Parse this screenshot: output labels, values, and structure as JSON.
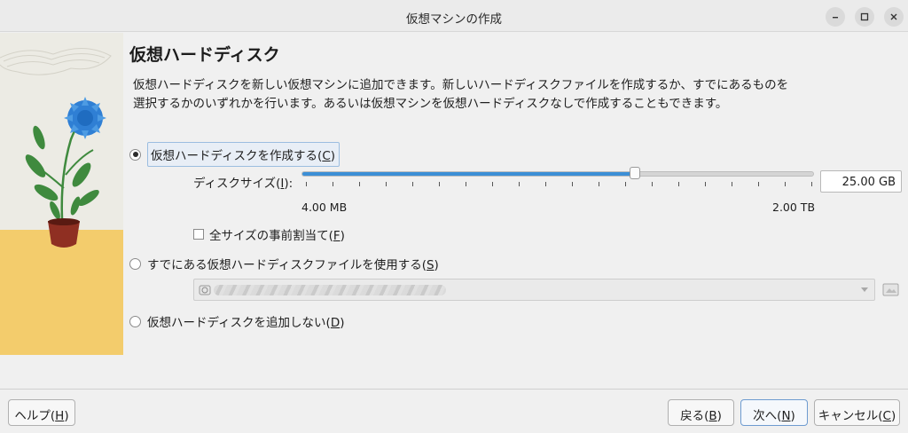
{
  "window": {
    "title": "仮想マシンの作成"
  },
  "page": {
    "heading": "仮想ハードディスク",
    "description": "仮想ハードディスクを新しい仮想マシンに追加できます。新しいハードディスクファイルを作成するか、すでにあるものを選択するかのいずれかを行います。あるいは仮想マシンを仮想ハードディスクなしで作成することもできます。"
  },
  "options": {
    "create": {
      "label": "仮想ハードディスクを作成する(",
      "mnemonic": "C",
      "label_end": ")",
      "selected": true
    },
    "existing": {
      "label": "すでにある仮想ハードディスクファイルを使用する(",
      "mnemonic": "S",
      "label_end": ")",
      "selected": false
    },
    "none": {
      "label": "仮想ハードディスクを追加しない(",
      "mnemonic": "D",
      "label_end": ")",
      "selected": false
    }
  },
  "disk_size": {
    "label": "ディスクサイズ(",
    "mnemonic": "I",
    "label_end": "):",
    "value": "25.00 GB",
    "min_label": "4.00 MB",
    "max_label": "2.00 TB",
    "slider_fraction": 0.65
  },
  "preallocate": {
    "label": "全サイズの事前割当て(",
    "mnemonic": "F",
    "label_end": ")",
    "checked": false
  },
  "buttons": {
    "help": {
      "label": "ヘルプ(",
      "mnemonic": "H",
      "label_end": ")"
    },
    "back": {
      "label": "戻る(",
      "mnemonic": "B",
      "label_end": ")"
    },
    "next": {
      "label": "次へ(",
      "mnemonic": "N",
      "label_end": ")"
    },
    "cancel": {
      "label": "キャンセル(",
      "mnemonic": "C",
      "label_end": ")"
    }
  },
  "colors": {
    "accent": "#3c8fd6",
    "illustration_bg": "#ecebe4",
    "illustration_floor": "#f3cc6c",
    "flower": "#2f7fd4",
    "pot": "#8f2f22",
    "leaf": "#3f8a3e"
  }
}
